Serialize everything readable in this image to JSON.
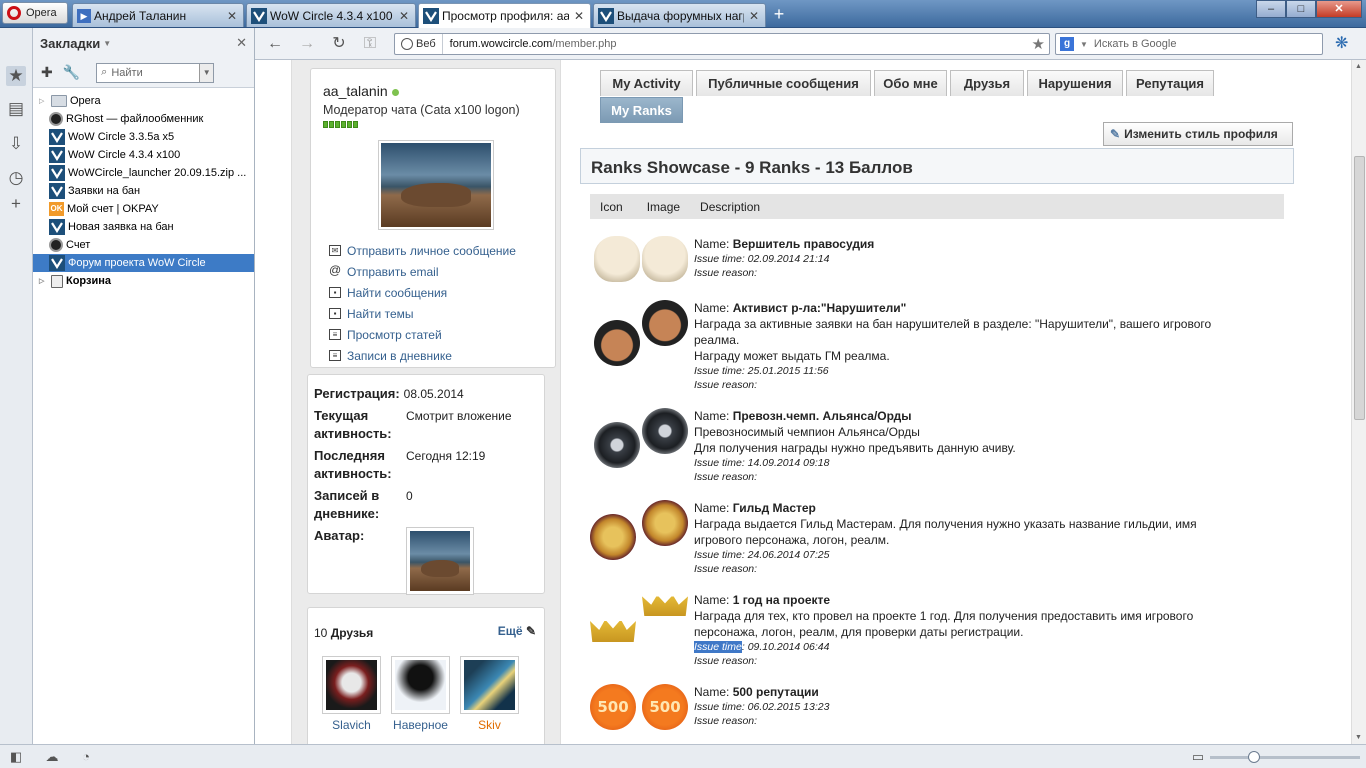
{
  "browser": {
    "menu_label": "Opera",
    "tabs": [
      {
        "label": "Андрей Таланин"
      },
      {
        "label": "WoW Circle 4.3.4 x100"
      },
      {
        "label": "Просмотр профиля: aa_..."
      },
      {
        "label": "Выдача форумных нагр..."
      }
    ],
    "new_tab": "+",
    "win_min": "–",
    "win_max": "□",
    "win_close": "✕"
  },
  "bookmarks": {
    "title": "Закладки",
    "search_placeholder": "Найти",
    "items": [
      {
        "label": "Opera"
      },
      {
        "label": "RGhost — файлообменник"
      },
      {
        "label": "WoW Circle 3.3.5a x5"
      },
      {
        "label": "WoW Circle 4.3.4 x100"
      },
      {
        "label": "WoWCircle_launcher 20.09.15.zip ..."
      },
      {
        "label": "Заявки на бан"
      },
      {
        "label": "Мой счет | OKPAY"
      },
      {
        "label": "Новая заявка на бан"
      },
      {
        "label": "Счет"
      },
      {
        "label": "Форум проекта WoW Circle"
      },
      {
        "label": "Корзина"
      }
    ]
  },
  "address": {
    "web_label": "Веб",
    "url_host": "forum.wowcircle.com",
    "url_path": "/member.php",
    "search_placeholder": "Искать в Google"
  },
  "profile": {
    "username": "aa_talanin",
    "user_title": "Модератор чата (Cata x100 logon)",
    "links": [
      {
        "label": "Отправить личное сообщение"
      },
      {
        "label": "Отправить email"
      },
      {
        "label": "Найти сообщения"
      },
      {
        "label": "Найти темы"
      },
      {
        "label": "Просмотр статей"
      },
      {
        "label": "Записи в дневнике"
      }
    ],
    "stats": [
      {
        "label": "Регистрация:",
        "value": "08.05.2014"
      },
      {
        "label": "Текущая активность:",
        "value": "Смотрит вложение"
      },
      {
        "label": "Последняя активность:",
        "value": "Сегодня 12:19"
      },
      {
        "label": "Записей в дневнике:",
        "value": "0"
      },
      {
        "label": "Аватар:",
        "value": ""
      }
    ],
    "friends_count": "10",
    "friends_label": "Друзья",
    "friends_more": "Ещё",
    "friends": [
      {
        "name": "Slavich",
        "color": "#35608e"
      },
      {
        "name": "Наверное",
        "color": "#35608e"
      },
      {
        "name": "Skiv",
        "color": "#e06c00"
      }
    ]
  },
  "content": {
    "tabs": [
      {
        "label": "My Activity",
        "active": false
      },
      {
        "label": "Публичные сообщения",
        "active": false
      },
      {
        "label": "Обо мне",
        "active": false
      },
      {
        "label": "Друзья",
        "active": false
      },
      {
        "label": "Нарушения",
        "active": false
      },
      {
        "label": "Репутация",
        "active": false
      },
      {
        "label": "My Ranks",
        "active": true
      }
    ],
    "change_style": "Изменить стиль профиля",
    "showcase_title": "Ranks Showcase - 9 Ranks - 13 Баллов",
    "table_headers": [
      "Icon",
      "Image",
      "Description"
    ],
    "name_label": "Name:",
    "ranks": [
      {
        "icon": "skull",
        "name": "Вершитель правосудия",
        "desc": [],
        "issue_time": "Issue time: 02.09.2014 21:14",
        "issue_reason": "Issue reason:"
      },
      {
        "icon": "cop",
        "name": "Активист р-ла:\"Нарушители\"",
        "desc": [
          "Награда за активные заявки на бан нарушителей в разделе: \"Нарушители\", вашего игрового",
          "реалма.",
          "Награду может выдать ГМ реалма."
        ],
        "issue_time": "Issue time: 25.01.2015 11:56",
        "issue_reason": "Issue reason:"
      },
      {
        "icon": "shield",
        "name": "Превозн.чемп. Альянса/Орды",
        "desc": [
          "Превозносимый чемпион Альянса/Орды",
          "Для получения награды нужно предъявить данную ачиву."
        ],
        "issue_time": "Issue time: 14.09.2014 09:18",
        "issue_reason": "Issue reason:"
      },
      {
        "icon": "lion",
        "name": "Гильд Мастер",
        "desc": [
          "Награда выдается Гильд Мастерам. Для получения нужно указать название гильдии, имя",
          "игрового персонажа, логон, реалм."
        ],
        "issue_time": "Issue time: 24.06.2014 07:25",
        "issue_reason": "Issue reason:"
      },
      {
        "icon": "crown",
        "name": "1 год на проекте",
        "desc": [
          "Награда для тех, кто провел на проекте 1 год. Для получения предоставить имя игрового",
          "персонажа, логон, реалм, для проверки даты регистрации."
        ],
        "issue_time_hl": "Issue time",
        "issue_time_rest": ": 09.10.2014 06:44",
        "issue_reason": "Issue reason:"
      },
      {
        "icon": "rep500",
        "icon_text": "500",
        "name": "500 репутации",
        "desc": [],
        "issue_time": "Issue time: 06.02.2015 13:23",
        "issue_reason": "Issue reason:"
      }
    ]
  }
}
